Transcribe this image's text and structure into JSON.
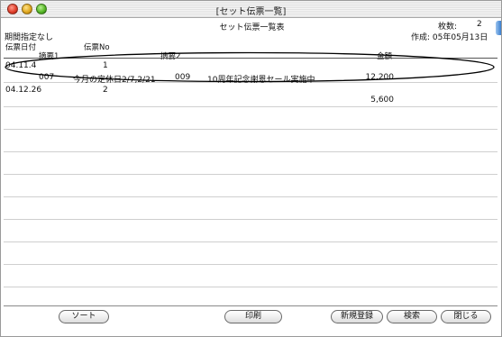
{
  "window": {
    "title": "[セット伝票一覧]"
  },
  "report": {
    "title": "セット伝票一覧表",
    "count_label": "枚数:",
    "count_value": "2",
    "period": "期間指定なし",
    "created": "作成: 05年05月13日"
  },
  "columns": {
    "date": "伝票日付",
    "slip_no": "伝票No",
    "summary1": "摘要1",
    "summary2": "摘要2",
    "amount": "金額"
  },
  "rows": [
    {
      "date": "04.11.4",
      "slip_no": "1",
      "summary1_code": "007",
      "summary1_text": "今月の定休日2/7,2/21",
      "summary2_code": "009",
      "summary2_text": "10周年記念謝恩セール実施中",
      "amount": "12,200"
    },
    {
      "date": "04.12.26",
      "slip_no": "2",
      "amount": "5,600"
    }
  ],
  "buttons": {
    "sort": "ソート",
    "print": "印刷",
    "new": "新規登録",
    "search": "検索",
    "close": "閉じる"
  }
}
